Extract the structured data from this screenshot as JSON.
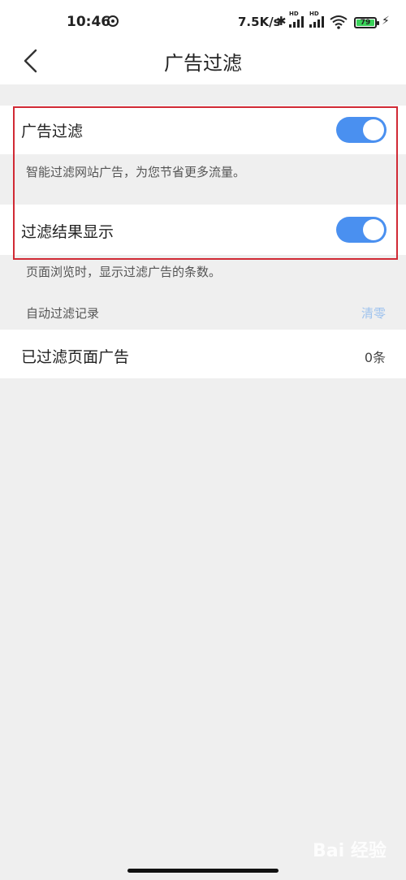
{
  "status_bar": {
    "time": "10:46",
    "net_speed": "7.5K/s",
    "battery": "79",
    "hd1": "HD",
    "hd2": "HD"
  },
  "header": {
    "title": "广告过滤",
    "back_icon": "chevron-left-icon"
  },
  "settings": {
    "ad_filter": {
      "label": "广告过滤",
      "enabled": true,
      "description": "智能过滤网站广告，为您节省更多流量。"
    },
    "show_filter_results": {
      "label": "过滤结果显示",
      "enabled": true,
      "description": "页面浏览时，显示过滤广告的条数。"
    },
    "auto_filter_log": {
      "section_label": "自动过滤记录",
      "clear_label": "清零"
    },
    "filtered_ads": {
      "label": "已过滤页面广告",
      "count": "0条"
    }
  },
  "colors": {
    "toggle_on": "#4a90f0",
    "highlight_border": "#d12a35",
    "link": "#9fc3ee"
  },
  "watermark": "Bai 经验"
}
